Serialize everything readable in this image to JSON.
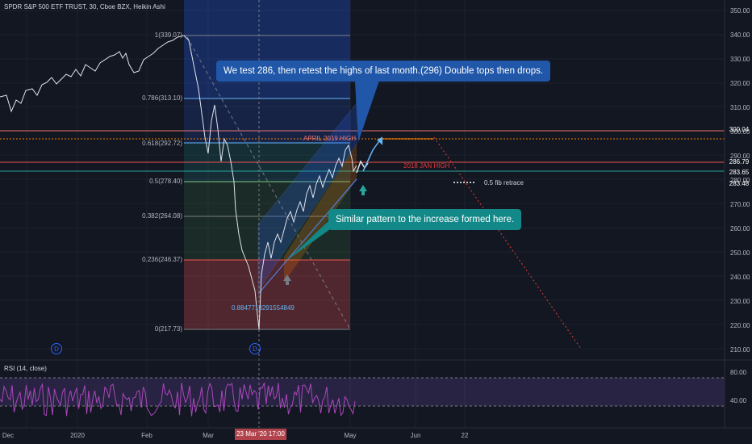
{
  "header": {
    "title": "SPDR S&P 500 ETF TRUST, 30, Cboe BZX, Heikin Ashi"
  },
  "rsi": {
    "title": "RSI (14, close)",
    "levels": [
      "80.00",
      "40.00"
    ]
  },
  "price_axis": [
    "350.00",
    "340.00",
    "330.00",
    "320.00",
    "310.00",
    "300.00",
    "290.00",
    "280.00",
    "270.00",
    "260.00",
    "250.00",
    "240.00",
    "230.00",
    "220.00",
    "210.00"
  ],
  "price_tags": [
    {
      "text": "300.04",
      "color": "#e57373"
    },
    {
      "text": "296.71",
      "color": "#f0c6a6"
    },
    {
      "text": "286.79",
      "color": "#ef5350"
    },
    {
      "text": "283.65",
      "color": "#ef5350"
    },
    {
      "text": "283.48",
      "color": "#26a69a"
    }
  ],
  "time_axis": [
    "Dec",
    "2020",
    "Feb",
    "Mar",
    "23 Mar '20  17:00",
    "May",
    "Jun",
    "22"
  ],
  "fib_levels": [
    {
      "label": "1(339.07)",
      "color": "#b2b5be"
    },
    {
      "label": "0.786(313.10)",
      "color": "#64b5f6"
    },
    {
      "label": "0.618(292.72)",
      "color": "#64b5f6"
    },
    {
      "label": "0.5(278.40)",
      "color": "#81c784"
    },
    {
      "label": "0.382(264.08)",
      "color": "#b2b5be"
    },
    {
      "label": "0.236(246.37)",
      "color": "#ef5350"
    },
    {
      "label": "0(217.73)",
      "color": "#b2b5be"
    }
  ],
  "annotations": {
    "callout_top": "We test 286, then retest the highs of last month.(296) Double tops then drops.",
    "callout_mid": "Similar pattern to the increase formed here.",
    "april_high": "APRIL 2019 HIGH",
    "jan_high": "2018 JAN HIGH",
    "fib_retrace": "0.5 fib retrace",
    "low_value": "0.8847718291554849",
    "dividend_marker": "D"
  },
  "colors": {
    "background": "#131722",
    "price_line": "#ffffff",
    "rsi_line": "#9c27b0",
    "accent": "#2962ff"
  }
}
